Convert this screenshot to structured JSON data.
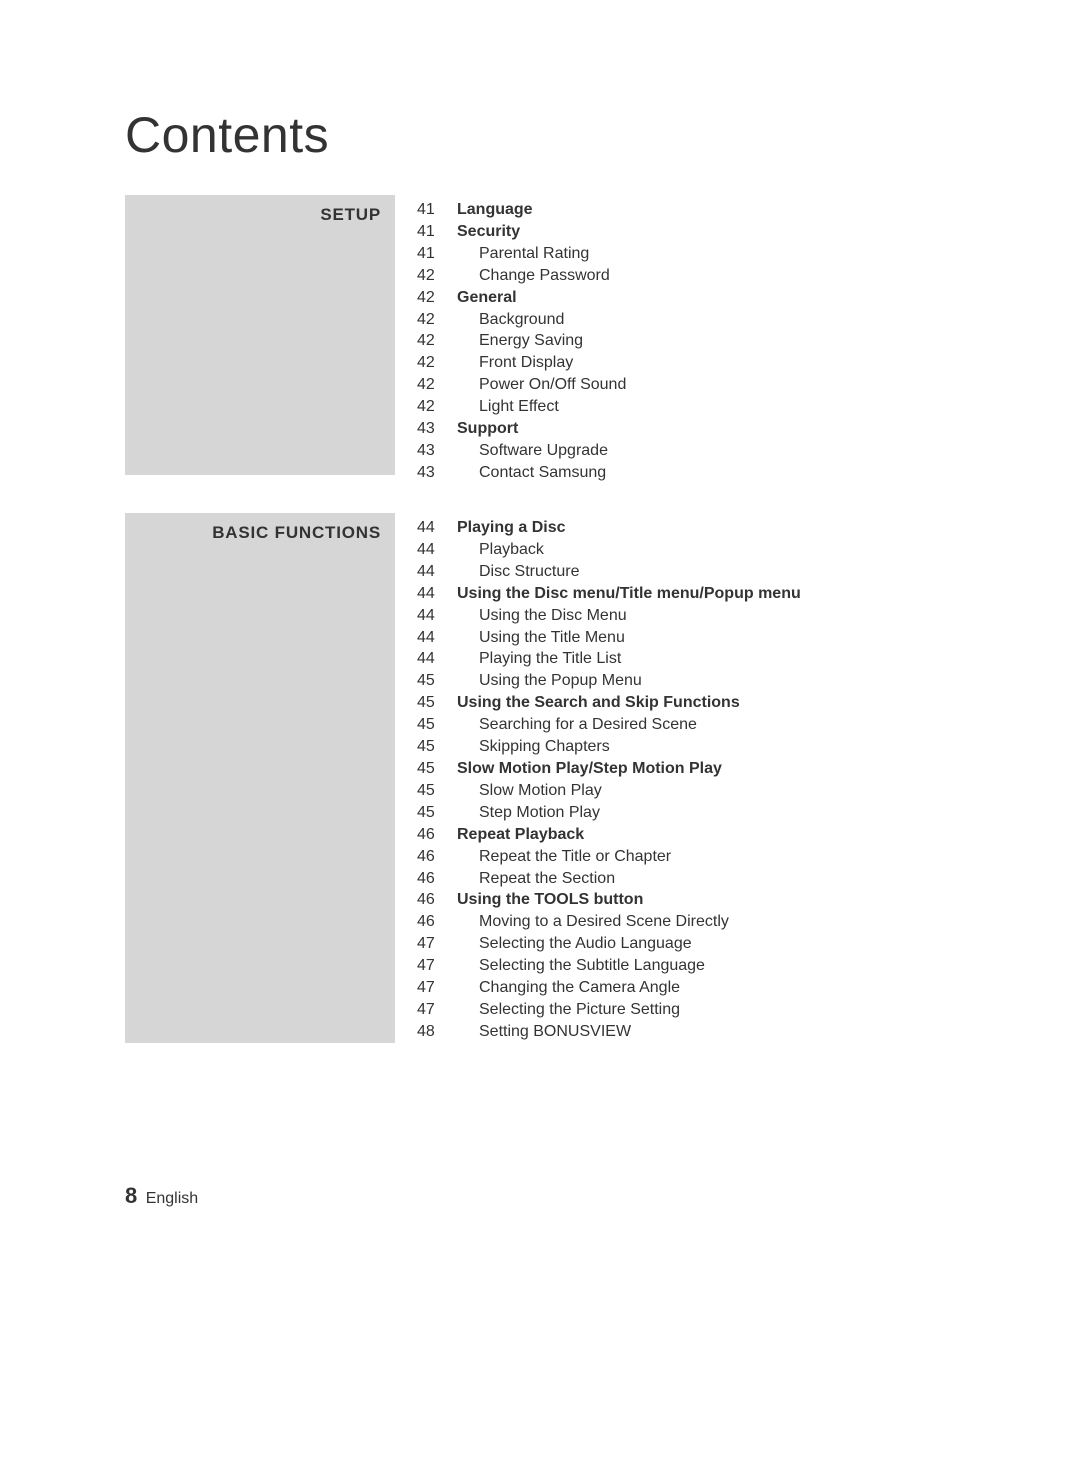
{
  "title": "Contents",
  "sections": [
    {
      "heading": "SETUP",
      "items": [
        {
          "page": "41",
          "text": "Language",
          "bold": true,
          "indent": false
        },
        {
          "page": "41",
          "text": "Security",
          "bold": true,
          "indent": false
        },
        {
          "page": "41",
          "text": "Parental Rating",
          "bold": false,
          "indent": true
        },
        {
          "page": "42",
          "text": "Change Password",
          "bold": false,
          "indent": true
        },
        {
          "page": "42",
          "text": "General",
          "bold": true,
          "indent": false
        },
        {
          "page": "42",
          "text": "Background",
          "bold": false,
          "indent": true
        },
        {
          "page": "42",
          "text": "Energy Saving",
          "bold": false,
          "indent": true
        },
        {
          "page": "42",
          "text": "Front Display",
          "bold": false,
          "indent": true
        },
        {
          "page": "42",
          "text": "Power On/Off Sound",
          "bold": false,
          "indent": true
        },
        {
          "page": "42",
          "text": "Light Effect",
          "bold": false,
          "indent": true
        },
        {
          "page": "43",
          "text": "Support",
          "bold": true,
          "indent": false
        },
        {
          "page": "43",
          "text": "Software Upgrade",
          "bold": false,
          "indent": true
        },
        {
          "page": "43",
          "text": "Contact Samsung",
          "bold": false,
          "indent": true
        }
      ]
    },
    {
      "heading": "BASIC FUNCTIONS",
      "items": [
        {
          "page": "44",
          "text": "Playing a Disc",
          "bold": true,
          "indent": false
        },
        {
          "page": "44",
          "text": "Playback",
          "bold": false,
          "indent": true
        },
        {
          "page": "44",
          "text": "Disc Structure",
          "bold": false,
          "indent": true
        },
        {
          "page": "44",
          "text": "Using the Disc menu/Title menu/Popup menu",
          "bold": true,
          "indent": false
        },
        {
          "page": "44",
          "text": "Using the Disc Menu",
          "bold": false,
          "indent": true
        },
        {
          "page": "44",
          "text": "Using the Title Menu",
          "bold": false,
          "indent": true
        },
        {
          "page": "44",
          "text": "Playing the Title List",
          "bold": false,
          "indent": true
        },
        {
          "page": "45",
          "text": "Using the Popup Menu",
          "bold": false,
          "indent": true
        },
        {
          "page": "45",
          "text": "Using the Search and Skip Functions",
          "bold": true,
          "indent": false
        },
        {
          "page": "45",
          "text": "Searching for a Desired Scene",
          "bold": false,
          "indent": true
        },
        {
          "page": "45",
          "text": "Skipping Chapters",
          "bold": false,
          "indent": true
        },
        {
          "page": "45",
          "text": "Slow Motion Play/Step Motion Play",
          "bold": true,
          "indent": false
        },
        {
          "page": "45",
          "text": "Slow Motion Play",
          "bold": false,
          "indent": true
        },
        {
          "page": "45",
          "text": "Step Motion Play",
          "bold": false,
          "indent": true
        },
        {
          "page": "46",
          "text": "Repeat Playback",
          "bold": true,
          "indent": false
        },
        {
          "page": "46",
          "text": "Repeat the Title or Chapter",
          "bold": false,
          "indent": true
        },
        {
          "page": "46",
          "text": "Repeat the Section",
          "bold": false,
          "indent": true
        },
        {
          "page": "46",
          "text": "Using the TOOLS button",
          "bold": true,
          "indent": false
        },
        {
          "page": "46",
          "text": "Moving to a Desired Scene Directly",
          "bold": false,
          "indent": true
        },
        {
          "page": "47",
          "text": "Selecting the Audio Language",
          "bold": false,
          "indent": true
        },
        {
          "page": "47",
          "text": "Selecting the Subtitle Language",
          "bold": false,
          "indent": true
        },
        {
          "page": "47",
          "text": "Changing the Camera Angle",
          "bold": false,
          "indent": true
        },
        {
          "page": "47",
          "text": "Selecting the Picture Setting",
          "bold": false,
          "indent": true
        },
        {
          "page": "48",
          "text": "Setting BONUSVIEW",
          "bold": false,
          "indent": true
        }
      ]
    }
  ],
  "footer": {
    "pageNumber": "8",
    "language": "English"
  }
}
